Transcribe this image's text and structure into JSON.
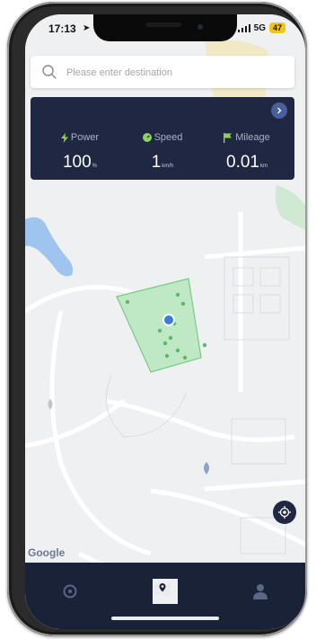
{
  "status_bar": {
    "time": "17:13",
    "network": "5G",
    "battery": "47"
  },
  "search": {
    "placeholder": "Please enter destination"
  },
  "stats": {
    "power": {
      "label": "Power",
      "value": "100",
      "unit": "%"
    },
    "speed": {
      "label": "Speed",
      "value": "1",
      "unit": "km/h"
    },
    "mileage": {
      "label": "Mileage",
      "value": "0.01",
      "unit": "km"
    }
  },
  "map": {
    "attribution": "Google"
  },
  "colors": {
    "panel": "#1f2742",
    "accent_green": "#8ed35a",
    "tabbar": "#1a2238",
    "battery": "#f2c318"
  },
  "tabs": [
    {
      "name": "home-tab",
      "icon": "circle-icon"
    },
    {
      "name": "map-tab",
      "icon": "map-pin-icon"
    },
    {
      "name": "profile-tab",
      "icon": "person-icon"
    }
  ]
}
